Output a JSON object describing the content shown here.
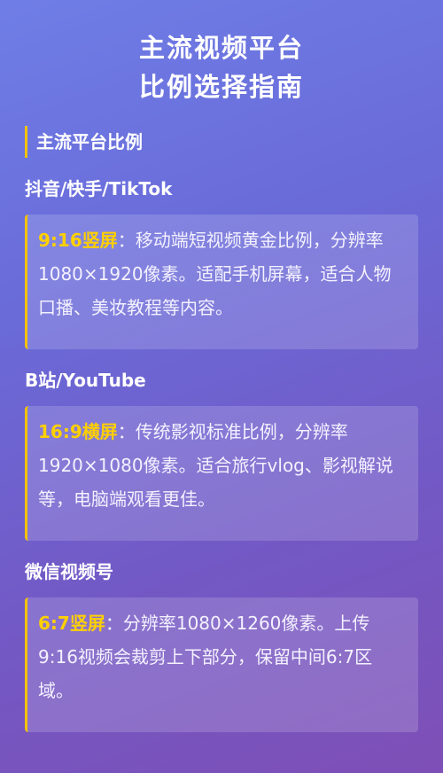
{
  "title": {
    "line1": "主流视频平台",
    "line2": "比例选择指南"
  },
  "section": {
    "heading": "主流平台比例"
  },
  "platforms": [
    {
      "name": "抖音/快手/TikTok",
      "ratio_label": "9:16竖屏",
      "separator": "：",
      "description": "移动端短视频黄金比例，分辨率1080×1920像素。适配手机屏幕，适合人物口播、美妆教程等内容。"
    },
    {
      "name": "B站/YouTube",
      "ratio_label": "16:9横屏",
      "separator": "：",
      "description": "传统影视标准比例，分辨率1920×1080像素。适合旅行vlog、影视解说等，电脑端观看更佳。"
    },
    {
      "name": "微信视频号",
      "ratio_label": "6:7竖屏",
      "separator": "：",
      "description": "分辨率1080×1260像素。上传9:16视频会裁剪上下部分，保留中间6:7区域。"
    }
  ],
  "colors": {
    "accent": "#f2c200",
    "highlight": "#ffd000",
    "background_start": "#6f7ee6",
    "background_end": "#7e4fb6"
  }
}
